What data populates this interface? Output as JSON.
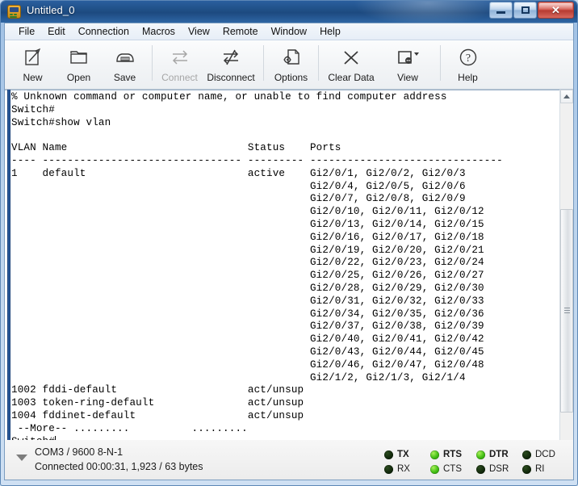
{
  "window": {
    "title": "Untitled_0",
    "app_icon": "terminal-device-icon",
    "caption": {
      "minimize": "minimize-button",
      "maximize": "maximize-button",
      "close": "✕"
    }
  },
  "menubar": {
    "items": [
      {
        "label": "File",
        "name": "menu-file"
      },
      {
        "label": "Edit",
        "name": "menu-edit"
      },
      {
        "label": "Connection",
        "name": "menu-connection"
      },
      {
        "label": "Macros",
        "name": "menu-macros"
      },
      {
        "label": "View",
        "name": "menu-view"
      },
      {
        "label": "Remote",
        "name": "menu-remote"
      },
      {
        "label": "Window",
        "name": "menu-window"
      },
      {
        "label": "Help",
        "name": "menu-help"
      }
    ]
  },
  "toolbar": {
    "buttons": [
      {
        "label": "New",
        "icon": "new-document-icon",
        "disabled": false
      },
      {
        "label": "Open",
        "icon": "open-folder-icon",
        "disabled": false
      },
      {
        "label": "Save",
        "icon": "save-disk-icon",
        "disabled": false
      },
      {
        "label": "Connect",
        "icon": "connect-arrows-icon",
        "disabled": true
      },
      {
        "label": "Disconnect",
        "icon": "disconnect-arrows-icon",
        "disabled": false
      },
      {
        "label": "Options",
        "icon": "options-gear-document-icon",
        "disabled": false
      },
      {
        "label": "Clear Data",
        "icon": "clear-x-icon",
        "disabled": false
      },
      {
        "label": "View",
        "icon": "view-screen-icon",
        "disabled": false
      },
      {
        "label": "Help",
        "icon": "help-question-icon",
        "disabled": false
      }
    ]
  },
  "terminal": {
    "text": "% Unknown command or computer name, or unable to find computer address\nSwitch#\nSwitch#show vlan\n\nVLAN Name                             Status    Ports\n---- -------------------------------- --------- -------------------------------\n1    default                          active    Gi2/0/1, Gi2/0/2, Gi2/0/3\n                                                Gi2/0/4, Gi2/0/5, Gi2/0/6\n                                                Gi2/0/7, Gi2/0/8, Gi2/0/9\n                                                Gi2/0/10, Gi2/0/11, Gi2/0/12\n                                                Gi2/0/13, Gi2/0/14, Gi2/0/15\n                                                Gi2/0/16, Gi2/0/17, Gi2/0/18\n                                                Gi2/0/19, Gi2/0/20, Gi2/0/21\n                                                Gi2/0/22, Gi2/0/23, Gi2/0/24\n                                                Gi2/0/25, Gi2/0/26, Gi2/0/27\n                                                Gi2/0/28, Gi2/0/29, Gi2/0/30\n                                                Gi2/0/31, Gi2/0/32, Gi2/0/33\n                                                Gi2/0/34, Gi2/0/35, Gi2/0/36\n                                                Gi2/0/37, Gi2/0/38, Gi2/0/39\n                                                Gi2/0/40, Gi2/0/41, Gi2/0/42\n                                                Gi2/0/43, Gi2/0/44, Gi2/0/45\n                                                Gi2/0/46, Gi2/0/47, Gi2/0/48\n                                                Gi2/1/2, Gi2/1/3, Gi2/1/4\n1002 fddi-default                     act/unsup\n1003 token-ring-default               act/unsup\n1004 fddinet-default                  act/unsup\n --More-- .........          .........\nSwitch#"
  },
  "scrollbar": {
    "up_arrow": "scroll-up-arrow",
    "down_arrow": "scroll-down-arrow"
  },
  "statusbar": {
    "line1": "COM3 / 9600 8-N-1",
    "line2": "Connected 00:00:31, 1,923 / 63 bytes",
    "leds": [
      {
        "label": "TX",
        "on": false,
        "bold": true
      },
      {
        "label": "RTS",
        "on": true,
        "bold": true
      },
      {
        "label": "DTR",
        "on": true,
        "bold": true
      },
      {
        "label": "DCD",
        "on": false,
        "bold": false
      },
      {
        "label": "RX",
        "on": false,
        "bold": false
      },
      {
        "label": "CTS",
        "on": true,
        "bold": false
      },
      {
        "label": "DSR",
        "on": false,
        "bold": false
      },
      {
        "label": "RI",
        "on": false,
        "bold": false
      }
    ]
  },
  "colors": {
    "titlebar": "#1f4e85",
    "led_on": "#3fbd12",
    "led_off": "#16310d",
    "terminal_bg": "#ffffff",
    "terminal_fg": "#000000",
    "close_button": "#c0392b"
  }
}
